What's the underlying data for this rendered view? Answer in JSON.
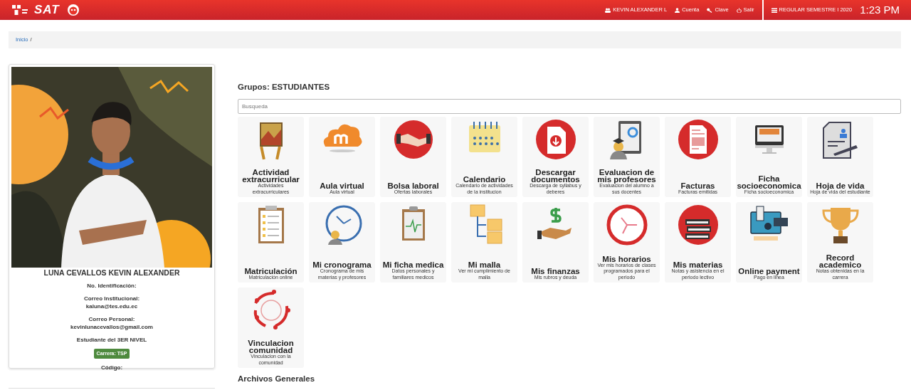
{
  "header": {
    "logo_text": "SAT",
    "user": "KEVIN ALEXANDER L",
    "links": [
      "Cuenta",
      "Clave",
      "Salir"
    ],
    "period": "REGULAR SEMESTRE I 2020",
    "time": "1:23 PM"
  },
  "breadcrumb": {
    "items": [
      {
        "label": "Inicio"
      }
    ],
    "separator": "/"
  },
  "profile": {
    "name": "LUNA CEVALLOS KEVIN ALEXANDER",
    "lines": [
      {
        "kind": "field",
        "label": "No. Identificación:"
      },
      {
        "kind": "field",
        "label": "Correo Institucional:",
        "value": "kaluna@tes.edu.ec"
      },
      {
        "kind": "field",
        "label": "Correo Personal:",
        "value": "kevinlunacevallos@gmail.com"
      },
      {
        "kind": "text",
        "text": "Estudiante del 3ER NIVEL"
      },
      {
        "kind": "badge",
        "text": "Carrera: TSP"
      },
      {
        "kind": "field",
        "label": "Código:"
      }
    ]
  },
  "groups": {
    "title": "Grupos: ESTUDIANTES",
    "search": {
      "placeholder": "Busqueda"
    },
    "tiles": [
      {
        "title": "Actividad extracurricular",
        "subtitle": "Actividades extracurriculares"
      },
      {
        "title": "Aula virtual",
        "subtitle": "Aula virtual"
      },
      {
        "title": "Bolsa laboral",
        "subtitle": "Ofertas laborales"
      },
      {
        "title": "Calendario",
        "subtitle": "Calendario de actividades de la institucion"
      },
      {
        "title": "Descargar documentos",
        "subtitle": "Descarga de syllabus y deberes"
      },
      {
        "title": "Evaluacion de mis profesores",
        "subtitle": "Evaluacion del alumno a sus docentes"
      },
      {
        "title": "Facturas",
        "subtitle": "Facturas emitidas"
      },
      {
        "title": "Ficha socioeconomica",
        "subtitle": "Ficha socioeconomica"
      },
      {
        "title": "Hoja de vida",
        "subtitle": "Hoja de vida del estudiante"
      },
      {
        "title": "Matriculación",
        "subtitle": "Matriculación online"
      },
      {
        "title": "Mi cronograma",
        "subtitle": "Cronograma de mis materias y profesores"
      },
      {
        "title": "Mi ficha medica",
        "subtitle": "Datos personales y familiares medicos"
      },
      {
        "title": "Mi malla",
        "subtitle": "Ver mi cumplimiento de malla"
      },
      {
        "title": "Mis finanzas",
        "subtitle": "Mis rubros y deuda"
      },
      {
        "title": "Mis horarios",
        "subtitle": "Ver mis horarios de clases programados para el periodo"
      },
      {
        "title": "Mis materias",
        "subtitle": "Notas y asistencia en el periodo lectivo"
      },
      {
        "title": "Online payment",
        "subtitle": "Pago en linea"
      },
      {
        "title": "Record academico",
        "subtitle": "Notas obtenidas en la carrera"
      },
      {
        "title": "Vinculacion comunidad",
        "subtitle": "Vinculacion con la comunidad"
      }
    ]
  },
  "files_title": "Archivos Generales"
}
